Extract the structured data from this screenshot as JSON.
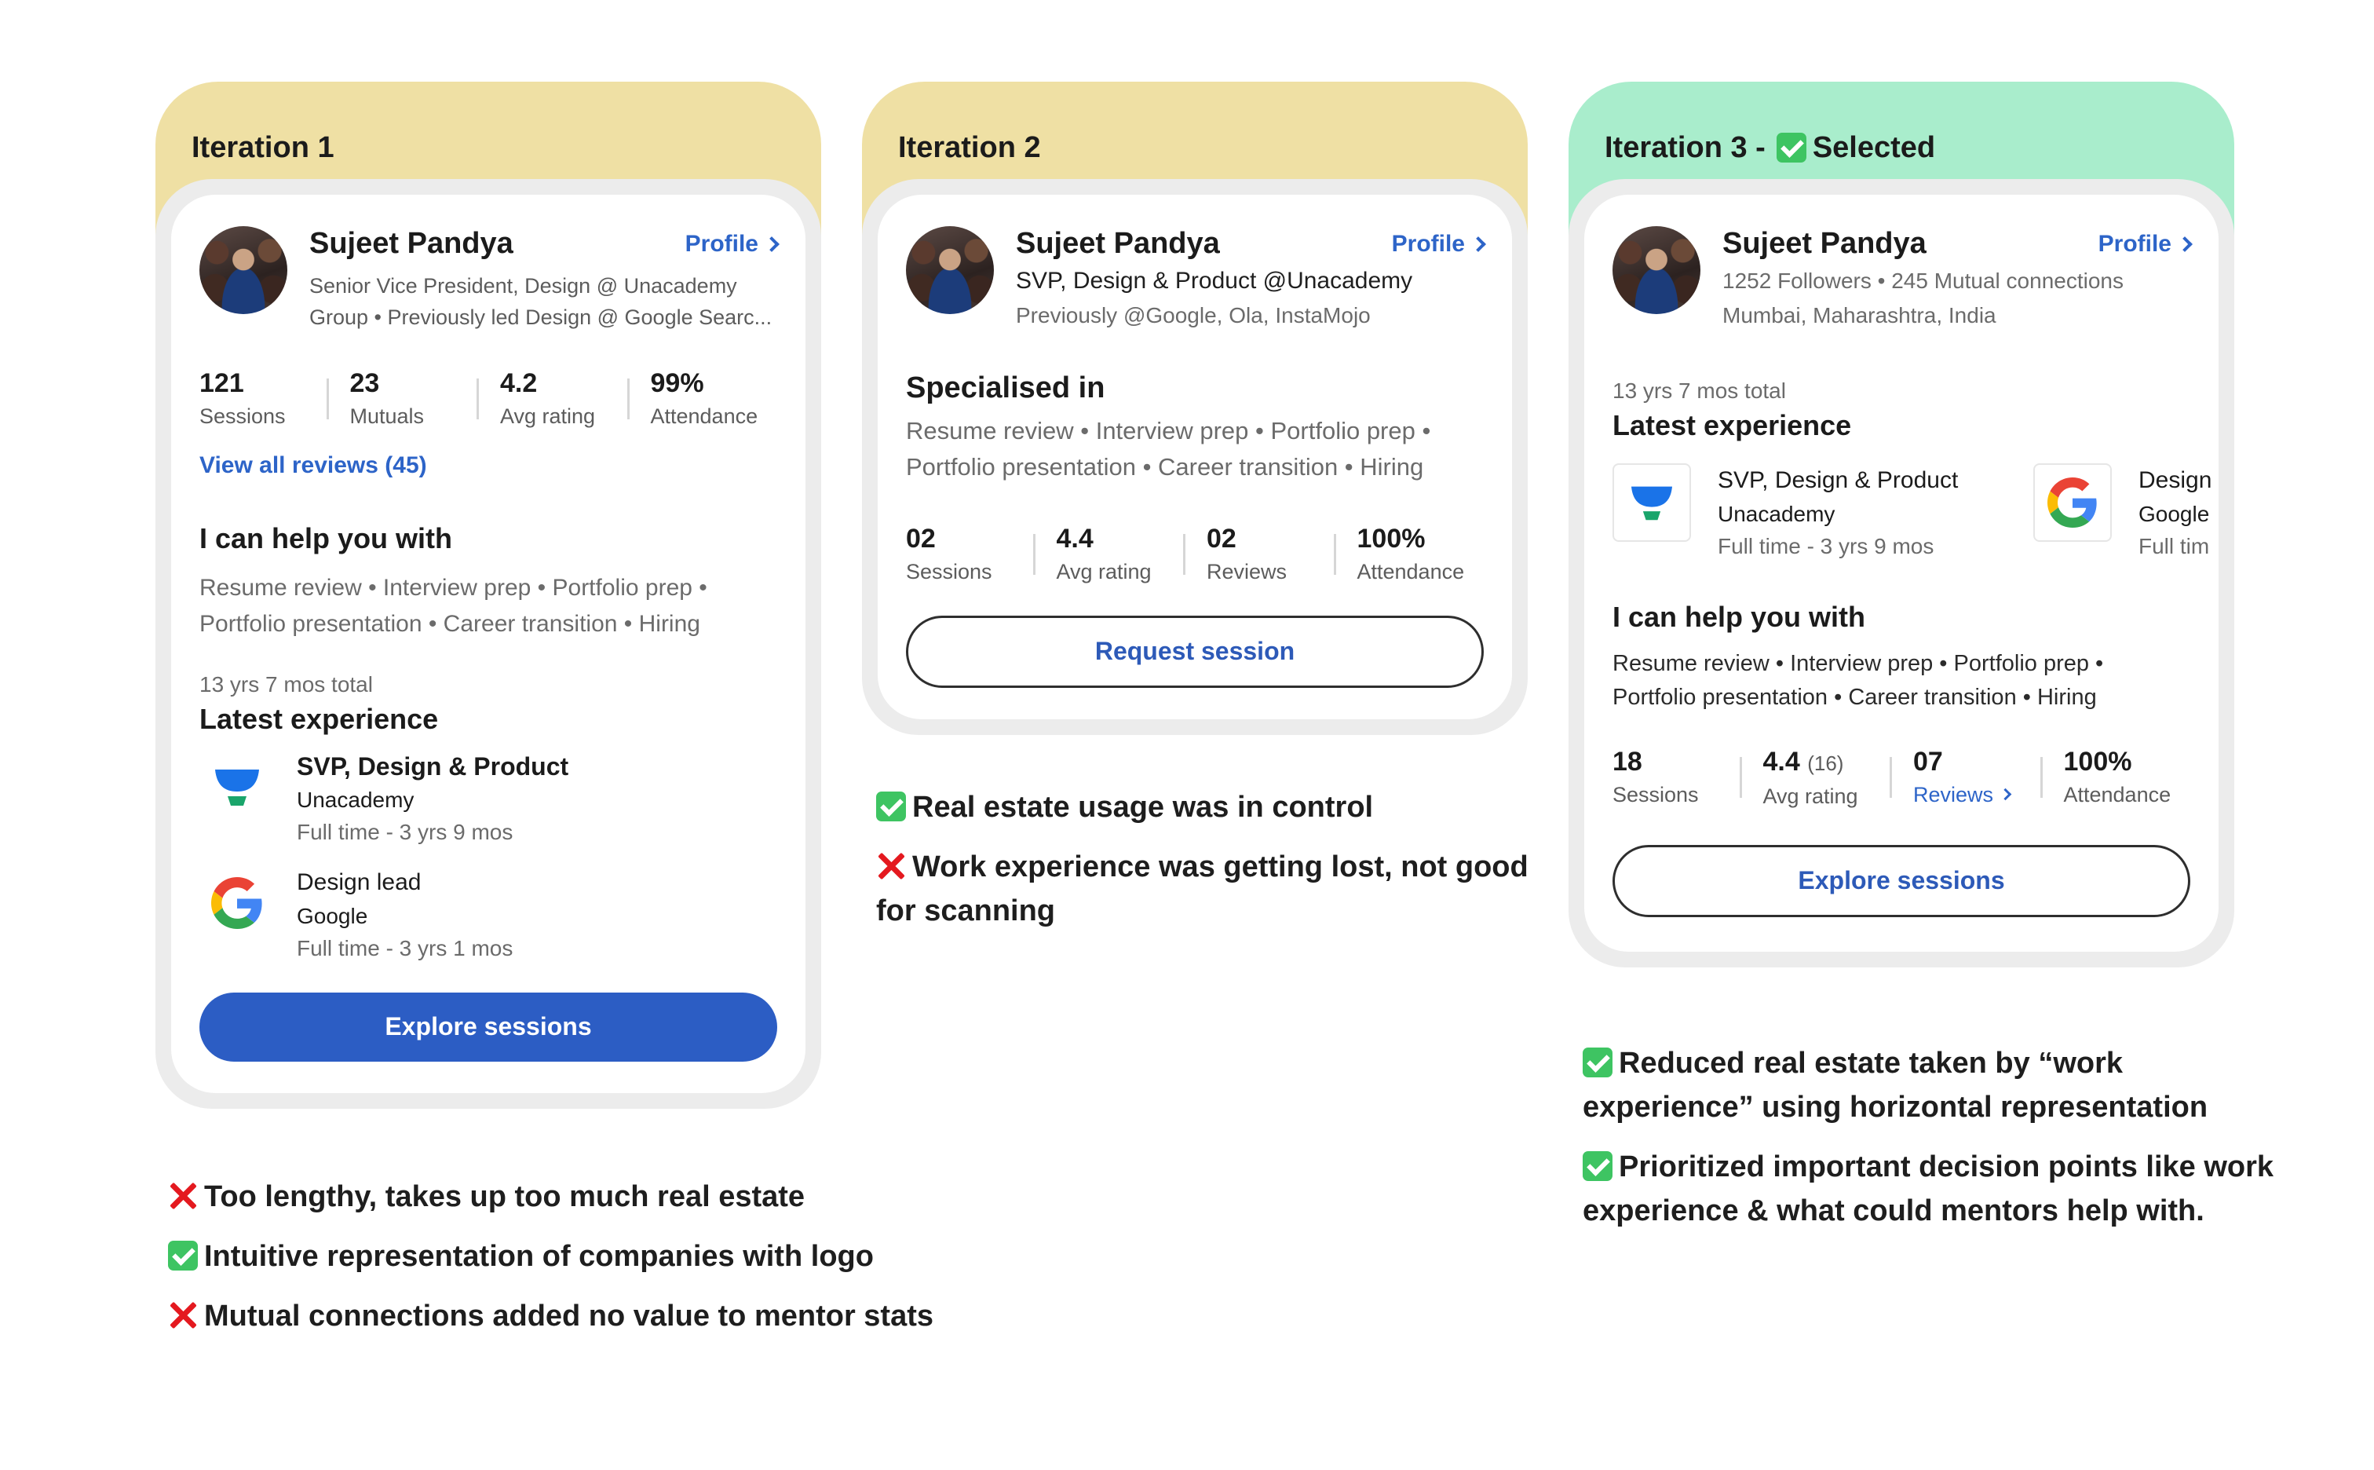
{
  "mentor": {
    "name": "Sujeet Pandya",
    "profile_label": "Profile"
  },
  "iteration1": {
    "title": "Iteration 1",
    "headline1": "Senior Vice President, Design @ Unacademy",
    "headline2": "Group • Previously led Design @ Google Searc...",
    "stats": [
      {
        "value": "121",
        "label": "Sessions"
      },
      {
        "value": "23",
        "label": "Mutuals"
      },
      {
        "value": "4.2",
        "label": "Avg rating"
      },
      {
        "value": "99%",
        "label": "Attendance"
      }
    ],
    "reviews_link": "View all reviews (45)",
    "help_title": "I can help you with",
    "help_line1": "Resume review • Interview prep • Portfolio prep •",
    "help_line2": "Portfolio presentation • Career transition • Hiring",
    "exp_total": "13 yrs 7 mos total",
    "exp_title": "Latest experience",
    "experiences": [
      {
        "role": "SVP, Design & Product",
        "company": "Unacademy",
        "duration": "Full time - 3 yrs 9 mos",
        "logo": "unacademy-logo"
      },
      {
        "role": "Design lead",
        "company": "Google",
        "duration": "Full time - 3 yrs 1 mos",
        "logo": "google-logo"
      }
    ],
    "cta": "Explore sessions",
    "notes": [
      {
        "mark": "cross",
        "text": "Too lengthy, takes up too much real estate"
      },
      {
        "mark": "check",
        "text": "Intuitive representation of companies with logo"
      },
      {
        "mark": "cross",
        "text": "Mutual connections added no value to mentor stats"
      }
    ]
  },
  "iteration2": {
    "title": "Iteration 2",
    "headline1": "SVP, Design & Product @Unacademy",
    "headline2": "Previously @Google, Ola, InstaMojo",
    "spec_title": "Specialised in",
    "spec_line1": "Resume review • Interview prep • Portfolio prep •",
    "spec_line2": "Portfolio presentation • Career transition • Hiring",
    "stats": [
      {
        "value": "02",
        "label": "Sessions"
      },
      {
        "value": "4.4",
        "label": "Avg rating"
      },
      {
        "value": "02",
        "label": "Reviews"
      },
      {
        "value": "100%",
        "label": "Attendance"
      }
    ],
    "cta": "Request session",
    "notes": [
      {
        "mark": "check",
        "text": "Real estate usage was in control"
      },
      {
        "mark": "cross",
        "text": "Work experience was getting lost, not good"
      },
      {
        "mark": "none",
        "text": "for scanning"
      }
    ]
  },
  "iteration3": {
    "title": "Iteration 3 -",
    "selected_label": "Selected",
    "headline1": "1252 Followers • 245 Mutual connections",
    "headline2": "Mumbai, Maharashtra, India",
    "exp_total": "13 yrs 7 mos total",
    "exp_title": "Latest experience",
    "experiences": [
      {
        "role": "SVP, Design & Product",
        "company": "Unacademy",
        "duration": "Full time - 3 yrs 9 mos",
        "logo": "unacademy-logo"
      },
      {
        "role": "Design",
        "company": "Google",
        "duration": "Full tim",
        "logo": "google-logo"
      }
    ],
    "help_title": "I can help you with",
    "help_line1": "Resume review • Interview prep • Portfolio prep •",
    "help_line2": "Portfolio presentation • Career transition • Hiring",
    "stats": [
      {
        "value": "18",
        "extra": "",
        "label": "Sessions"
      },
      {
        "value": "4.4",
        "extra": "(16)",
        "label": "Avg rating"
      },
      {
        "value": "07",
        "extra": "",
        "label": "Reviews"
      },
      {
        "value": "100%",
        "extra": "",
        "label": "Attendance"
      }
    ],
    "cta": "Explore sessions",
    "notes": [
      {
        "mark": "check",
        "text": "Reduced real estate taken by “work"
      },
      {
        "mark": "none",
        "text": "experience” using horizontal representation"
      },
      {
        "mark": "check",
        "text": "Prioritized important decision points like work"
      },
      {
        "mark": "none",
        "text": "experience & what could mentors help with."
      }
    ]
  },
  "colors": {
    "yellow_frame": "#efe0a4",
    "green_frame": "#a9edcc",
    "link_blue": "#2d64c8",
    "primary_button": "#2c5dc4",
    "check_green": "#3ec462",
    "cross_red": "#e4191f"
  }
}
